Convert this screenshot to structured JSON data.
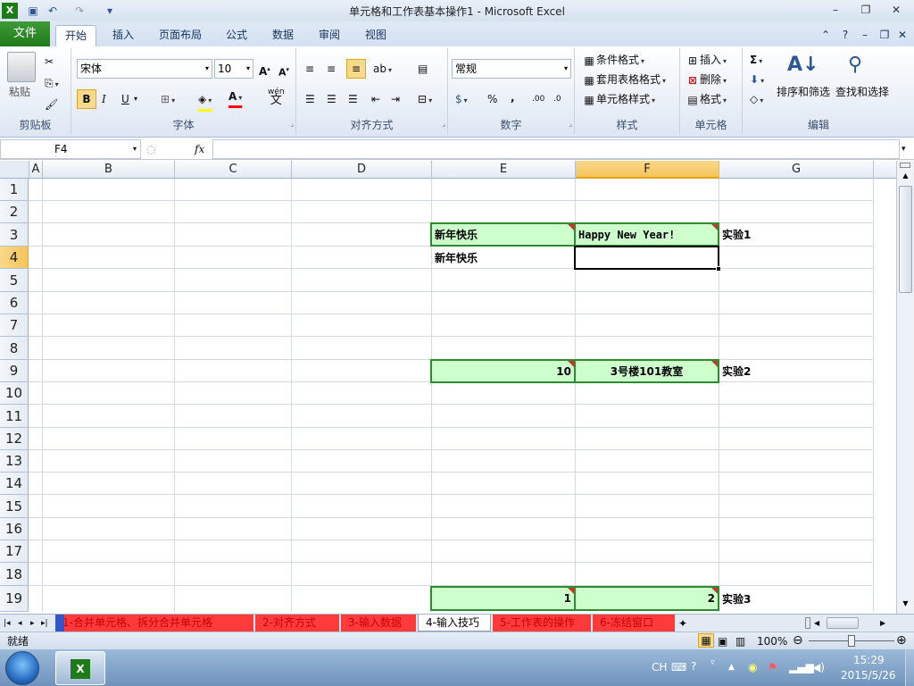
{
  "window": {
    "title": "单元格和工作表基本操作1 - Microsoft Excel"
  },
  "ribbon_tabs": [
    "文件",
    "开始",
    "插入",
    "页面布局",
    "公式",
    "数据",
    "审阅",
    "视图"
  ],
  "ribbon": {
    "clipboard": {
      "paste": "粘贴",
      "label": "剪贴板"
    },
    "font": {
      "name": "宋体",
      "size": "10",
      "bold": "B",
      "italic": "I",
      "underline": "U",
      "label": "字体",
      "wen": "wén",
      "wen_char": "文"
    },
    "alignment": {
      "label": "对齐方式"
    },
    "number": {
      "format": "常规",
      "percent": "%",
      "comma": ",",
      "label": "数字"
    },
    "styles": {
      "conditional": "条件格式",
      "table": "套用表格格式",
      "cell": "单元格样式",
      "label": "样式"
    },
    "cells": {
      "insert": "插入",
      "delete": "删除",
      "format": "格式",
      "label": "单元格"
    },
    "editing": {
      "sigma": "Σ",
      "sort": "排序和筛选",
      "find": "查找和选择",
      "label": "编辑"
    }
  },
  "formula_bar": {
    "name_box": "F4",
    "fx": "fx",
    "value": ""
  },
  "columns": [
    "A",
    "B",
    "C",
    "D",
    "E",
    "F",
    "G"
  ],
  "selected_column": "F",
  "rows": [
    "1",
    "2",
    "3",
    "4",
    "5",
    "6",
    "7",
    "8",
    "9",
    "10",
    "11",
    "12",
    "13",
    "14",
    "15",
    "16",
    "17",
    "18",
    "19"
  ],
  "selected_row": "4",
  "cells": {
    "E3": "新年快乐",
    "F3": "Happy New Year!",
    "G3": "实验1",
    "E4": "新年快乐",
    "E9": "10",
    "F9": "3号楼101教室",
    "G9": "实验2",
    "E19": "1",
    "F19": "2",
    "G19": "实验3"
  },
  "sheet_tabs": [
    "1-合并单元格、拆分合并单元格",
    "2-对齐方式",
    "3-输入数据",
    "4-输入技巧",
    "5-工作表的操作",
    "6-冻结窗口"
  ],
  "active_sheet": "4-输入技巧",
  "status": {
    "ready": "就绪",
    "zoom": "100%"
  },
  "taskbar": {
    "lang": "CH",
    "time": "15:29",
    "date": "2015/5/26"
  },
  "colors": {
    "green_fill": "#ccffcc",
    "green_border": "#2e8b2e",
    "excel_green": "#1f7a1a"
  }
}
